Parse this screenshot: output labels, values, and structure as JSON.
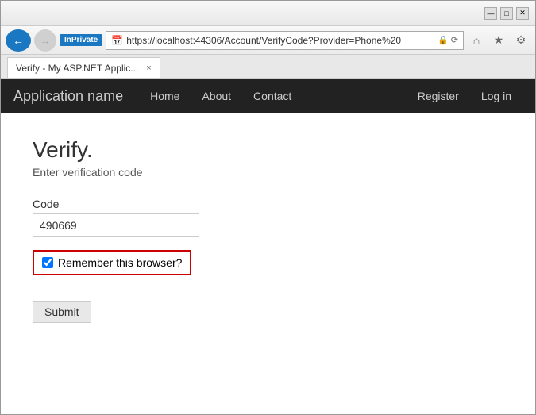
{
  "browser": {
    "title": "Verify - My ASP.NET Applic...",
    "url": "https://localhost:44306/Account/VerifyCode?Provider=Phone%20",
    "inprivate_label": "InPrivate",
    "tab_close": "×",
    "back_arrow": "←",
    "forward_arrow": "→"
  },
  "navbar": {
    "brand": "Application name",
    "links": [
      {
        "label": "Home"
      },
      {
        "label": "About"
      },
      {
        "label": "Contact"
      }
    ],
    "right_links": [
      {
        "label": "Register"
      },
      {
        "label": "Log in"
      }
    ]
  },
  "page": {
    "title": "Verify.",
    "subtitle": "Enter verification code",
    "code_label": "Code",
    "code_value": "490669",
    "code_placeholder": "",
    "remember_label": "Remember this browser?",
    "submit_label": "Submit"
  }
}
